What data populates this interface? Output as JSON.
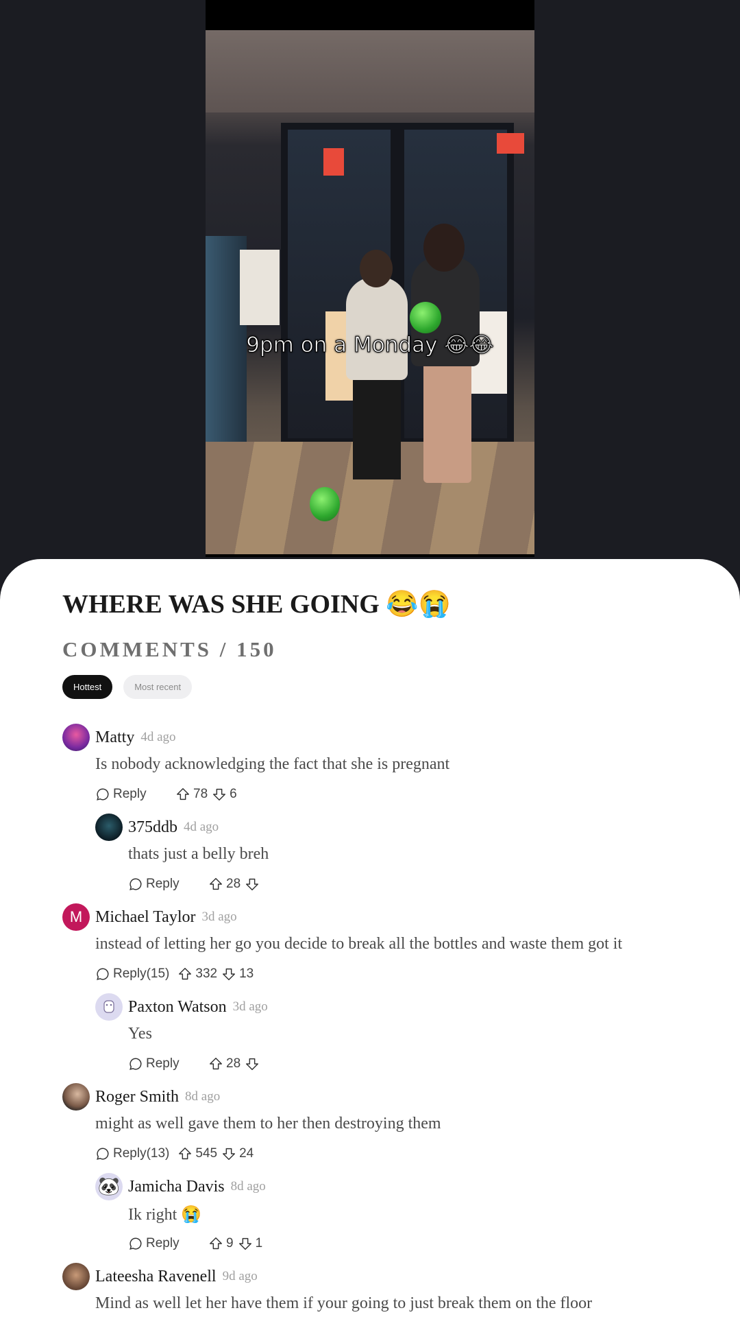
{
  "video": {
    "caption": "9pm on a Monday 😂😂"
  },
  "post": {
    "title": "WHERE WAS SHE GOING 😂😭",
    "comments_heading": "COMMENTS / 150"
  },
  "sort": {
    "hottest": "Hottest",
    "most_recent": "Most recent",
    "selected": "Hottest"
  },
  "comments": [
    {
      "author": "Matty",
      "time": "4d ago",
      "text": "Is nobody acknowledging the fact that she is pregnant",
      "reply": "Reply",
      "upvotes": "78",
      "downvotes": "6"
    },
    {
      "author": "375ddb",
      "time": "4d ago",
      "text": "thats just a belly breh",
      "reply": "Reply",
      "upvotes": "28",
      "downvotes": ""
    },
    {
      "author": "Michael Taylor",
      "initial": "M",
      "time": "3d ago",
      "text": "instead of letting her go you decide to break all the bottles and waste them got it",
      "reply": "Reply(15)",
      "upvotes": "332",
      "downvotes": "13"
    },
    {
      "author": "Paxton Watson",
      "time": "3d ago",
      "text": "Yes",
      "reply": "Reply",
      "upvotes": "28",
      "downvotes": ""
    },
    {
      "author": "Roger Smith",
      "time": "8d ago",
      "text": "might as well gave them to her then destroying them",
      "reply": "Reply(13)",
      "upvotes": "545",
      "downvotes": "24"
    },
    {
      "author": "Jamicha Davis",
      "avatar_emoji": "🐼",
      "time": "8d ago",
      "text": "Ik right 😭",
      "reply": "Reply",
      "upvotes": "9",
      "downvotes": "1"
    },
    {
      "author": "Lateesha Ravenell",
      "time": "9d ago",
      "text": "Mind as well let her have them if your going to just break them on the floor"
    }
  ]
}
